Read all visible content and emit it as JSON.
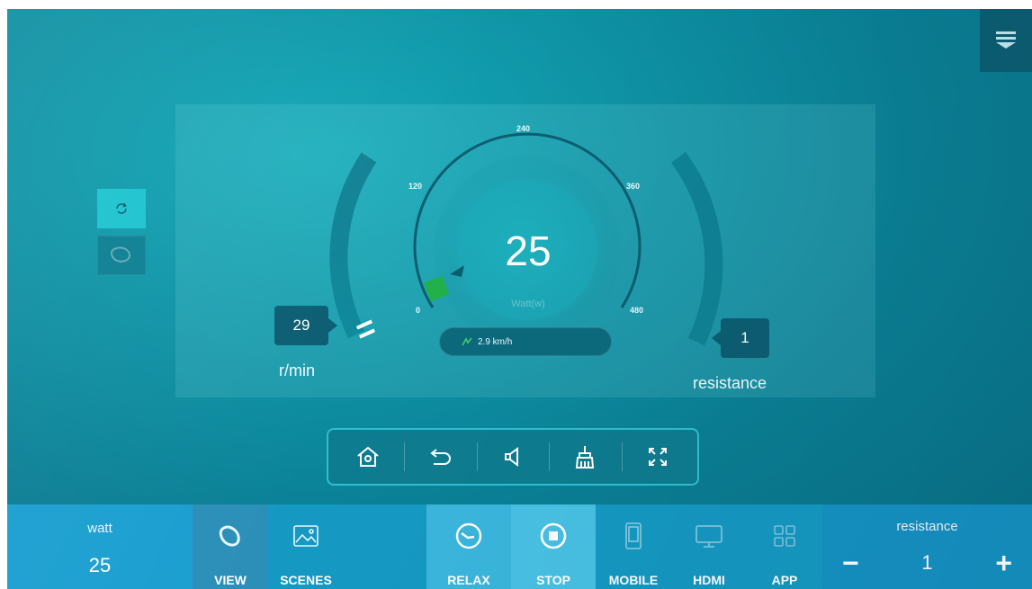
{
  "gauge": {
    "power_value": "25",
    "power_unit": "Watt(w)",
    "ticks": [
      "0",
      "120",
      "240",
      "360",
      "480"
    ],
    "speed": "2.9 km/h",
    "needle_fraction": 0.05
  },
  "cadence": {
    "value": "29",
    "unit": "r/min"
  },
  "resistance_readout": {
    "value": "1",
    "label": "resistance"
  },
  "toolbar": {
    "icons": [
      "home-icon",
      "back-icon",
      "volume-icon",
      "clean-icon",
      "fullscreen-icon"
    ]
  },
  "bottom": {
    "watt_label": "watt",
    "watt_value": "25",
    "view_label": "VIEW",
    "scenes_label": "SCENES",
    "relax_label": "RELAX",
    "stop_label": "STOP",
    "mobile_label": "MOBILE",
    "hdmi_label": "HDMI",
    "app_label": "APP",
    "resistance_label": "resistance",
    "resistance_value": "1",
    "minus": "−",
    "plus": "+"
  },
  "colors": {
    "background": "#0f94a6",
    "bottom_bar": "#1599c3",
    "accent": "#1cc4cf",
    "indicator_green": "#22b04b"
  }
}
